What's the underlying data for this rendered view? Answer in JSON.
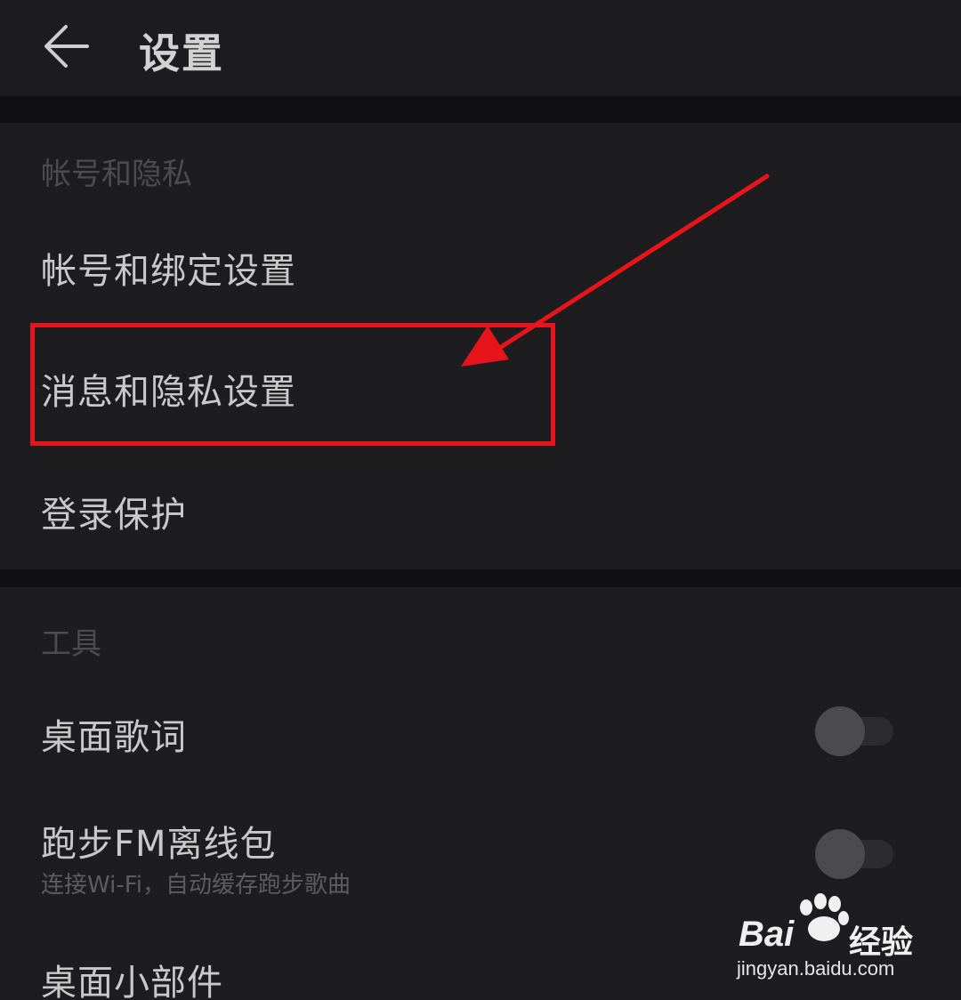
{
  "header": {
    "back_icon": "arrow-left-icon",
    "title": "设置"
  },
  "sections": {
    "account_privacy": {
      "title": "帐号和隐私",
      "items": [
        {
          "label": "帐号和绑定设置"
        },
        {
          "label": "消息和隐私设置"
        },
        {
          "label": "登录保护"
        }
      ]
    },
    "tools": {
      "title": "工具",
      "items": [
        {
          "label": "桌面歌词",
          "toggle": "off"
        },
        {
          "label": "跑步FM离线包",
          "sublabel": "连接Wi-Fi，自动缓存跑步歌曲",
          "toggle": "off"
        },
        {
          "label": "桌面小部件"
        }
      ]
    }
  },
  "annotation": {
    "color": "#e8141c",
    "highlighted_item": "消息和隐私设置"
  },
  "watermark": {
    "brand": "Bai",
    "suffix": "经验",
    "url": "jingyan.baidu.com"
  },
  "colors": {
    "background": "#1b1b1d",
    "text_primary": "#c9c9c9",
    "text_section": "#4c4c4e",
    "accent_red": "#e8141c"
  }
}
